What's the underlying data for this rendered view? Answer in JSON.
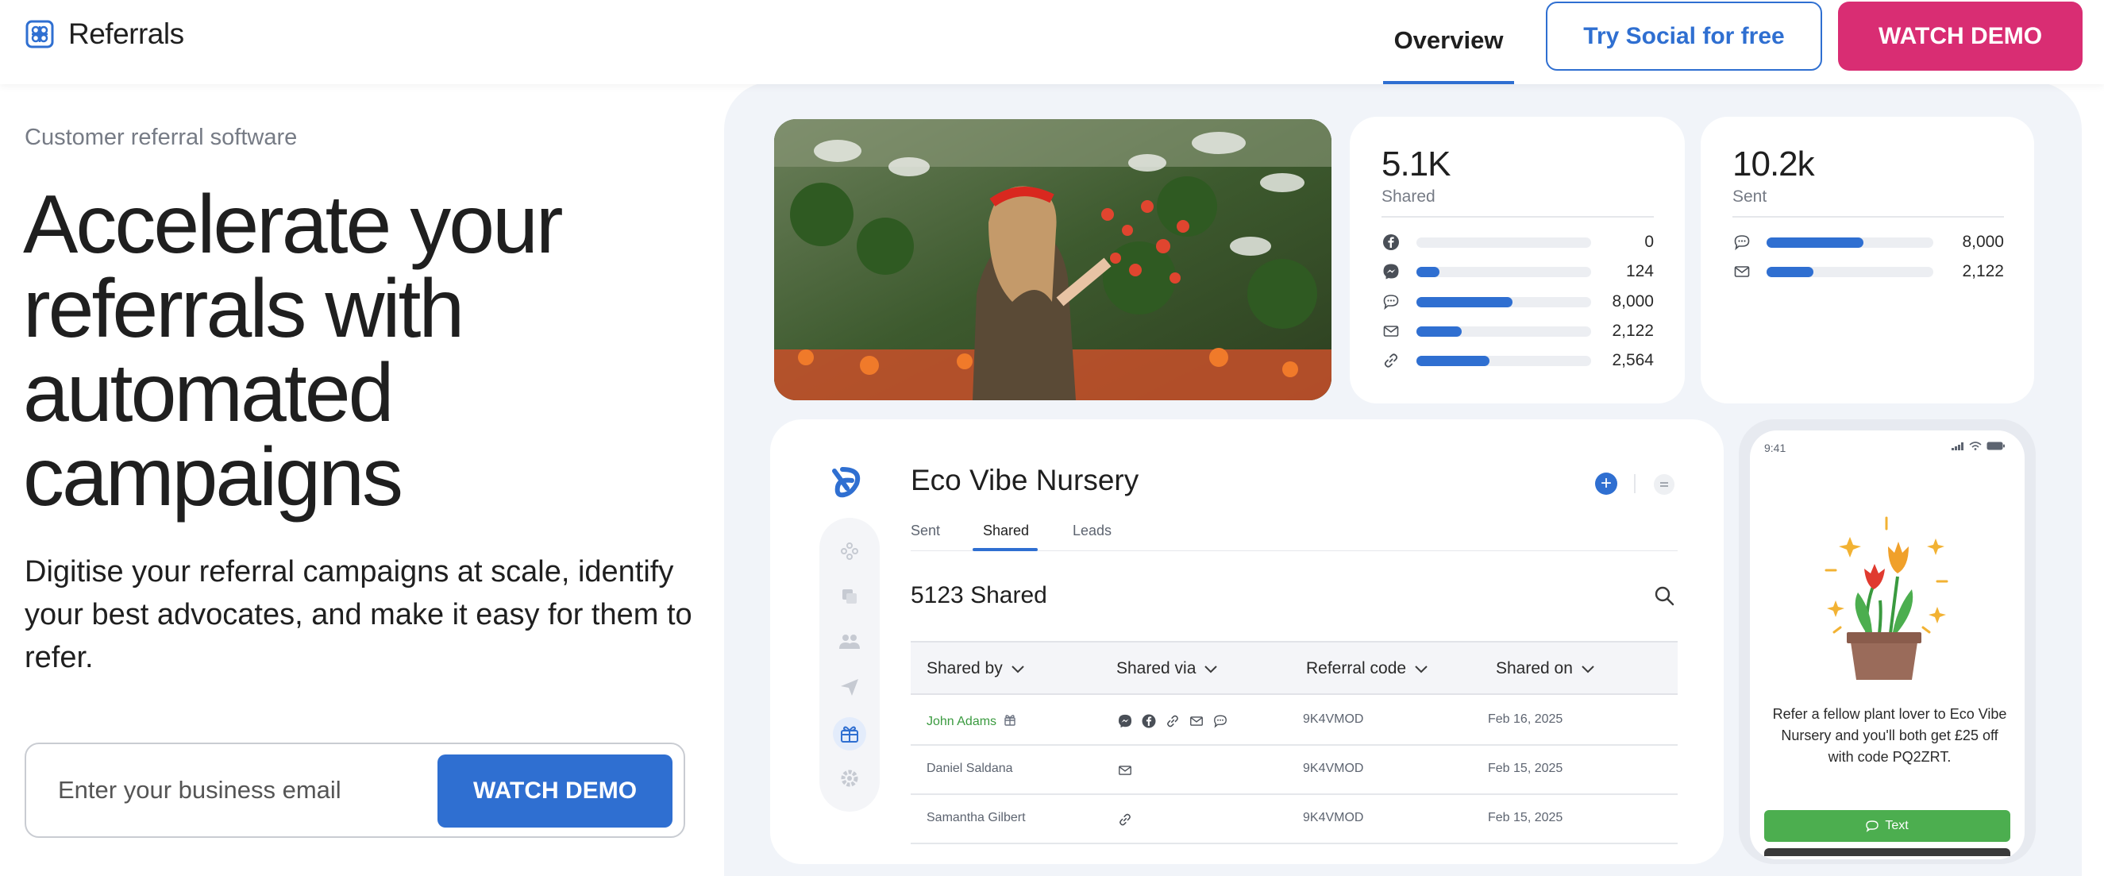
{
  "colors": {
    "accent": "#2f6fd1",
    "pink": "#d92d73",
    "green": "#4cae4f",
    "panel": "#f1f4f9"
  },
  "nav": {
    "brand": "Referrals",
    "overview": "Overview",
    "try_social": "Try Social for free",
    "watch_demo": "WATCH DEMO"
  },
  "hero": {
    "eyebrow": "Customer referral software",
    "title": "Accelerate your referrals with automated campaigns",
    "subtitle": "Digitise your referral campaigns at scale, identify your best advocates, and make it easy for them to refer.",
    "email_placeholder": "Enter your business email",
    "cta": "WATCH DEMO"
  },
  "shared_card": {
    "total": "5.1K",
    "label": "Shared",
    "rows": [
      {
        "icon": "facebook-icon",
        "value": "0",
        "fraction": 0.0
      },
      {
        "icon": "messenger-icon",
        "value": "124",
        "fraction": 0.13
      },
      {
        "icon": "sms-icon",
        "value": "8,000",
        "fraction": 0.55
      },
      {
        "icon": "email-icon",
        "value": "2,122",
        "fraction": 0.26
      },
      {
        "icon": "link-icon",
        "value": "2,564",
        "fraction": 0.42
      }
    ]
  },
  "sent_card": {
    "total": "10.2k",
    "label": "Sent",
    "rows": [
      {
        "icon": "sms-icon",
        "value": "8,000",
        "fraction": 0.58
      },
      {
        "icon": "email-icon",
        "value": "2,122",
        "fraction": 0.28
      }
    ]
  },
  "dashboard": {
    "title": "Eco Vibe Nursery",
    "tabs": [
      "Sent",
      "Shared",
      "Leads"
    ],
    "active_tab": "Shared",
    "count": "5123 Shared",
    "columns": [
      "Shared by",
      "Shared via",
      "Referral code",
      "Shared on"
    ],
    "rows": [
      {
        "name": "John Adams",
        "via": [
          "messenger-icon",
          "facebook-icon",
          "link-icon",
          "email-icon",
          "sms-icon"
        ],
        "code": "9K4VMOD",
        "date": "Feb 16, 2025"
      },
      {
        "name": "Daniel Saldana",
        "via": [
          "email-icon"
        ],
        "code": "9K4VMOD",
        "date": "Feb 15, 2025"
      },
      {
        "name": "Samantha Gilbert",
        "via": [
          "link-icon"
        ],
        "code": "9K4VMOD",
        "date": "Feb 15, 2025"
      }
    ]
  },
  "phone": {
    "time": "9:41",
    "message": "Refer a fellow plant lover to Eco Vibe Nursery and you'll both get £25 off with code PQ2ZRT.",
    "button": "Text"
  }
}
